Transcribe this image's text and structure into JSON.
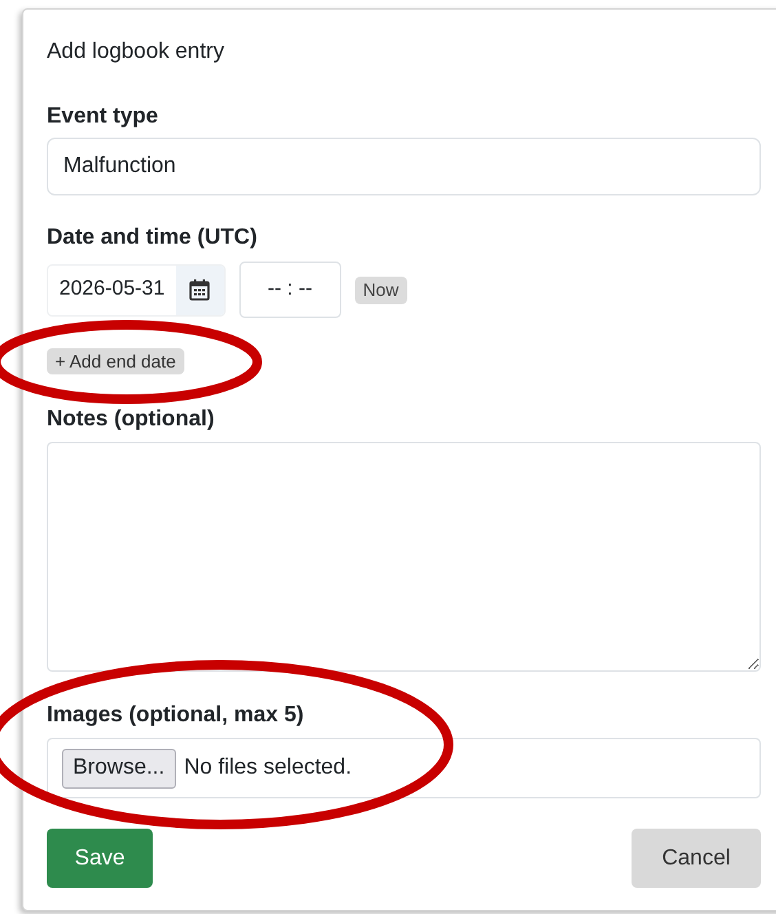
{
  "dialog": {
    "title": "Add logbook entry"
  },
  "event_type": {
    "label": "Event type",
    "value": "Malfunction"
  },
  "date_time": {
    "label": "Date and time (UTC)",
    "date": "2026-05-31",
    "time": "-- : --",
    "now_button": "Now"
  },
  "add_end_date": "+ Add end date",
  "notes": {
    "label": "Notes (optional)"
  },
  "images": {
    "label": "Images (optional, max 5)",
    "browse_button": "Browse...",
    "status": "No files selected."
  },
  "buttons": {
    "save": "Save",
    "cancel": "Cancel"
  }
}
